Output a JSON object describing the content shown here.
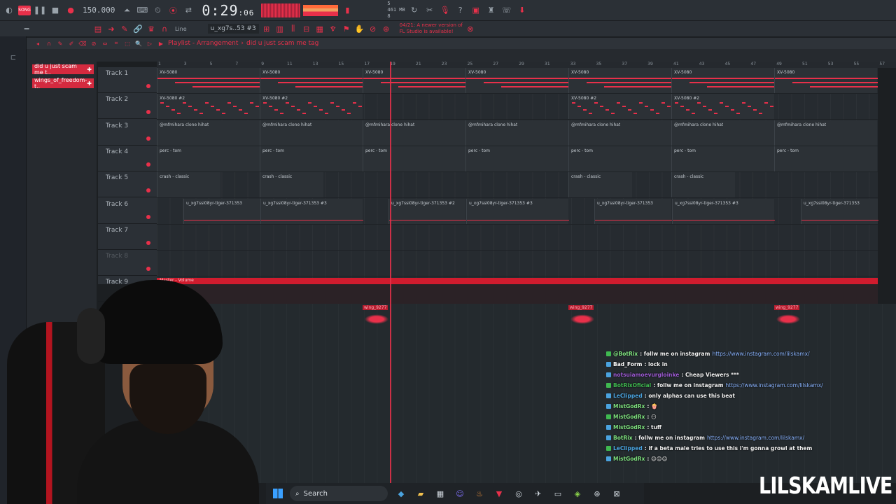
{
  "toolbar": {
    "song_label": "SONG",
    "tempo": "150.000",
    "time": "0:29",
    "time_frac": "06",
    "cpu_top": "5",
    "cpu_mid": "461 MB",
    "cpu_bot": "8"
  },
  "toolbar2": {
    "snap_label": "Line",
    "pattern_selector": "u_xg7s..53 #3",
    "news_line1": "04/21: A newer version of",
    "news_line2": "FL Studio is available!"
  },
  "playlist": {
    "title": "Playlist - Arrangement",
    "arrangement": "did u just scam me tag",
    "patterns": [
      "did u just scam me t..",
      "wings_of_freedom-t.."
    ],
    "ruler": [
      "1",
      "3",
      "5",
      "7",
      "9",
      "11",
      "13",
      "15",
      "17",
      "19",
      "21",
      "23",
      "25",
      "27",
      "29",
      "31",
      "33",
      "35",
      "37",
      "39",
      "41",
      "43",
      "45",
      "47",
      "49",
      "51",
      "53",
      "55",
      "57"
    ],
    "tracks": [
      "Track 1",
      "Track 2",
      "Track 3",
      "Track 4",
      "Track 5",
      "Track 6",
      "Track 7",
      "Track 8",
      "Track 9"
    ],
    "clips": {
      "t1": "XV-5080",
      "t2": "XV-5080 #2",
      "t3": "@mfmihara clone hihat",
      "t4": "perc - tom",
      "t5": "crash - classic",
      "t6a": "u_xg7ssi08yr-tiger-371353",
      "t6b": "u_xg7ssi08yr-tiger-371353 #3",
      "t6c": "u_xg7ssi08yr-tiger-371353 #2"
    },
    "automation_label": "Master - Volume",
    "wing_label": "wing_9277"
  },
  "chat": [
    {
      "user": "@BotRix",
      "text": ": follw me on instagram ",
      "link": "https://www.instagram.com/lilskamx/",
      "color": "#7ee07e"
    },
    {
      "user": "Bad_Form",
      "text": ": lock in",
      "link": "",
      "color": "#ffffff"
    },
    {
      "user": "notsuiamoevurgloinke",
      "text": ": Cheap Viewers ***",
      "link": "",
      "color": "#9b59d0"
    },
    {
      "user": "BotRixOficial",
      "text": ": follw me on instagram ",
      "link": "https://www.instagram.com/lilskamx/",
      "color": "#3fb950"
    },
    {
      "user": "LeClipped",
      "text": ": only alphas can use this beat",
      "link": "",
      "color": "#4aa3df"
    },
    {
      "user": "MistGodRx",
      "text": ": 🍿",
      "link": "",
      "color": "#7ee07e"
    },
    {
      "user": "MistGodRx",
      "text": ": 😶",
      "link": "",
      "color": "#7ee07e"
    },
    {
      "user": "MistGodRx",
      "text": ": tuff",
      "link": "",
      "color": "#7ee07e"
    },
    {
      "user": "BotRix",
      "text": ": follw me on instagram ",
      "link": "https://www.instagram.com/lilskamx/",
      "color": "#7ee07e"
    },
    {
      "user": "LeClipped",
      "text": ": if a beta male tries to use this i'm gonna growl at them",
      "link": "",
      "color": "#4aa3df"
    },
    {
      "user": "MistGodRx",
      "text": ": 😊😊😊",
      "link": "",
      "color": "#7ee07e"
    }
  ],
  "taskbar": {
    "search_label": "Search"
  },
  "brand": "LILSKAMLIVE"
}
